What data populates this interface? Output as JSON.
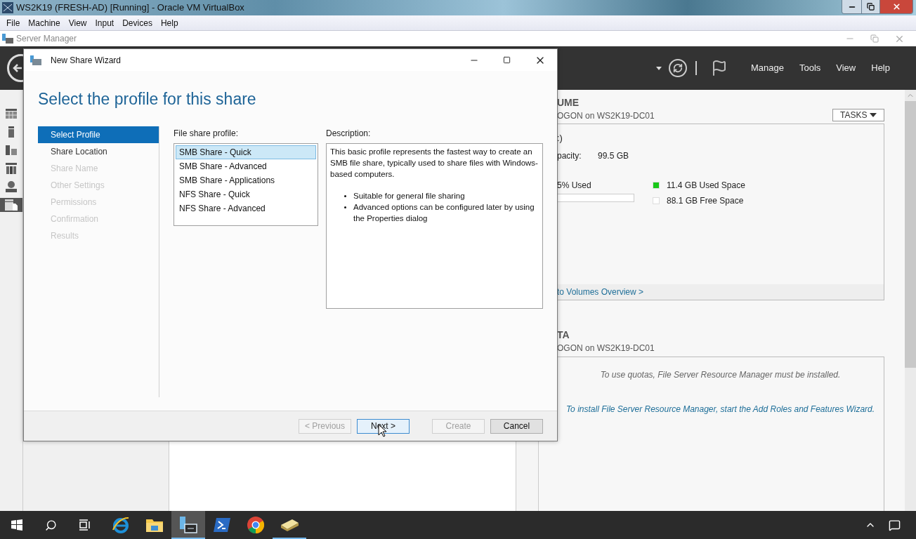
{
  "vbox": {
    "title": "WS2K19 (FRESH-AD) [Running] - Oracle VM VirtualBox",
    "menu": [
      "File",
      "Machine",
      "View",
      "Input",
      "Devices",
      "Help"
    ]
  },
  "server_manager": {
    "title": "Server Manager",
    "header_menu": [
      "Manage",
      "Tools",
      "View",
      "Help"
    ],
    "nav": [
      {
        "selected": false
      },
      {
        "selected": false
      },
      {
        "selected": false
      },
      {
        "selected": false
      },
      {
        "selected": false
      },
      {
        "selected": true
      }
    ],
    "volume": {
      "heading": "UME",
      "subtitle": "OGON on WS2K19-DC01",
      "tasks": "TASKS",
      "drive": ":)",
      "capacity_label": "pacity:",
      "capacity": "99.5 GB",
      "used_label": "5% Used",
      "legend": [
        {
          "label": "11.4 GB Used Space",
          "color": "#19c819"
        },
        {
          "label": "88.1 GB Free Space",
          "color": "#ffffff"
        }
      ],
      "link": "to Volumes Overview >"
    },
    "quota": {
      "heading": "TA",
      "subtitle": "OGON on WS2K19-DC01",
      "message": "To use quotas, File Server Resource Manager must be installed.",
      "link": "To install File Server Resource Manager, start the Add Roles and Features Wizard."
    }
  },
  "wizard": {
    "title": "New Share Wizard",
    "heading": "Select the profile for this share",
    "steps": [
      {
        "label": "Select Profile",
        "selected": true,
        "disabled": false
      },
      {
        "label": "Share Location",
        "selected": false,
        "disabled": false
      },
      {
        "label": "Share Name",
        "selected": false,
        "disabled": true
      },
      {
        "label": "Other Settings",
        "selected": false,
        "disabled": true
      },
      {
        "label": "Permissions",
        "selected": false,
        "disabled": true
      },
      {
        "label": "Confirmation",
        "selected": false,
        "disabled": true
      },
      {
        "label": "Results",
        "selected": false,
        "disabled": true
      }
    ],
    "profile_label": "File share profile:",
    "profiles": [
      {
        "label": "SMB Share - Quick",
        "selected": true
      },
      {
        "label": "SMB Share - Advanced",
        "selected": false
      },
      {
        "label": "SMB Share - Applications",
        "selected": false
      },
      {
        "label": "NFS Share - Quick",
        "selected": false
      },
      {
        "label": "NFS Share - Advanced",
        "selected": false
      }
    ],
    "description_label": "Description:",
    "description": "This basic profile represents the fastest way to create an SMB file share, typically used to share files with Windows-based computers.",
    "bullets": [
      "Suitable for general file sharing",
      "Advanced options can be configured later by using the Properties dialog"
    ],
    "buttons": [
      {
        "label": "< Previous",
        "disabled": true,
        "focused": false
      },
      {
        "label": "Next >",
        "disabled": false,
        "focused": true
      },
      {
        "label": "Create",
        "disabled": true,
        "focused": false
      },
      {
        "label": "Cancel",
        "disabled": false,
        "focused": false
      }
    ]
  },
  "taskbar": {
    "apps": [
      {
        "active": false,
        "running": false
      },
      {
        "active": false,
        "running": false
      },
      {
        "active": true,
        "running": true
      },
      {
        "active": false,
        "running": false
      },
      {
        "active": false,
        "running": false
      },
      {
        "active": false,
        "running": true
      }
    ]
  }
}
